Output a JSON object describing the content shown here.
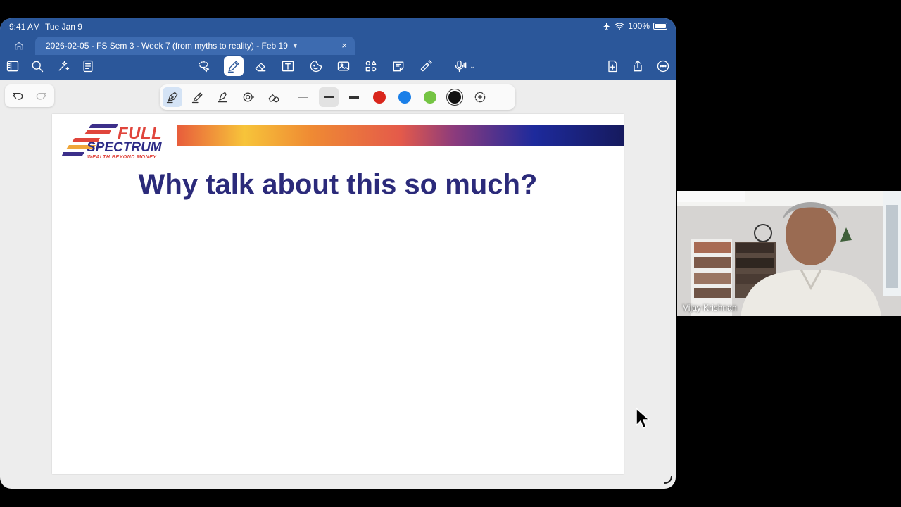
{
  "status_bar": {
    "time": "9:41 AM",
    "date": "Tue Jan 9",
    "battery": "100%",
    "icons": [
      "airplane-icon",
      "wifi-icon",
      "battery-icon"
    ]
  },
  "tabs": {
    "document_title": "2026-02-05 - FS Sem 3 - Week 7 (from myths to reality) - Feb 19",
    "close_label": "×"
  },
  "toolbar": {
    "left_tools": [
      "sidebar-icon",
      "search-icon",
      "magic-icon",
      "notebook-icon"
    ],
    "center_tools": [
      "lasso-icon",
      "pen-icon",
      "eraser-icon",
      "text-icon",
      "sticker-icon",
      "image-icon",
      "shapes-icon",
      "note-icon",
      "laser-icon",
      "microphone-icon"
    ],
    "right_tools": [
      "add-page-icon",
      "share-icon",
      "more-icon"
    ],
    "active_tool": "pen-icon"
  },
  "pen_toolbar": {
    "tools": [
      "fountain-pen-icon",
      "ball-pen-icon",
      "highlighter-icon",
      "tape-icon",
      "shape-eraser-icon"
    ],
    "active_tool": "fountain-pen-icon",
    "colors": [
      "#d9261c",
      "#1a7fe8",
      "#74c443",
      "#111111"
    ],
    "selected_color": "#111111"
  },
  "slide": {
    "logo": {
      "line1": "FULL",
      "line2": "SPECTRUM",
      "tagline": "WEALTH BEYOND MONEY"
    },
    "title": "Why talk about this so much?"
  },
  "video": {
    "participant_name": "Vijay Krishnan"
  }
}
